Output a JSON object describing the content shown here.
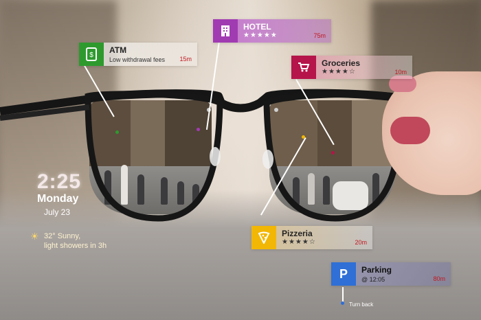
{
  "hud": {
    "atm": {
      "title": "ATM",
      "subtitle": "Low withdrawal fees",
      "distance": "15m",
      "accent": "#2e9a2e",
      "icon": "atm-icon"
    },
    "hotel": {
      "title": "HOTEL",
      "stars": "★★★★★",
      "distance": "75m",
      "accent": "#a13bb2",
      "icon": "hotel-building-icon"
    },
    "groceries": {
      "title": "Groceries",
      "stars": "★★★★☆",
      "distance": "10m",
      "accent": "#b5154a",
      "icon": "shopping-cart-icon"
    },
    "pizzeria": {
      "title": "Pizzeria",
      "stars": "★★★★☆",
      "distance": "20m",
      "accent": "#f2b705",
      "icon": "pizza-icon"
    },
    "parking": {
      "title": "Parking",
      "subtitle": "@ 12:05",
      "distance": "80m",
      "accent": "#2f6fd6",
      "icon": "parking-icon",
      "letter": "P"
    },
    "nav": {
      "turn_label": "Turn back"
    }
  },
  "status": {
    "time": "2:25",
    "day": "Monday",
    "date": "July 23",
    "weather_line1": "32° Sunny,",
    "weather_line2": "light showers in 3h",
    "sun_symbol": "☀"
  }
}
